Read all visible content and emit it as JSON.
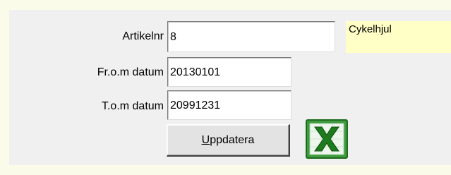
{
  "form": {
    "artikelnr_label": "Artikelnr",
    "artikelnr_value": "8",
    "from_date_label": "Fr.o.m datum",
    "from_date_value": "20130101",
    "to_date_label": "T.o.m datum",
    "to_date_value": "20991231",
    "article_name": "Cykelhjul"
  },
  "buttons": {
    "update_accel": "U",
    "update_rest": "ppdatera"
  },
  "icons": {
    "export": "excel-icon"
  },
  "colors": {
    "page_bg": "#fbfbe9",
    "panel_bg": "#f0f0f0",
    "info_bg": "#ffffc6",
    "excel_green": "#2e8b2e"
  }
}
